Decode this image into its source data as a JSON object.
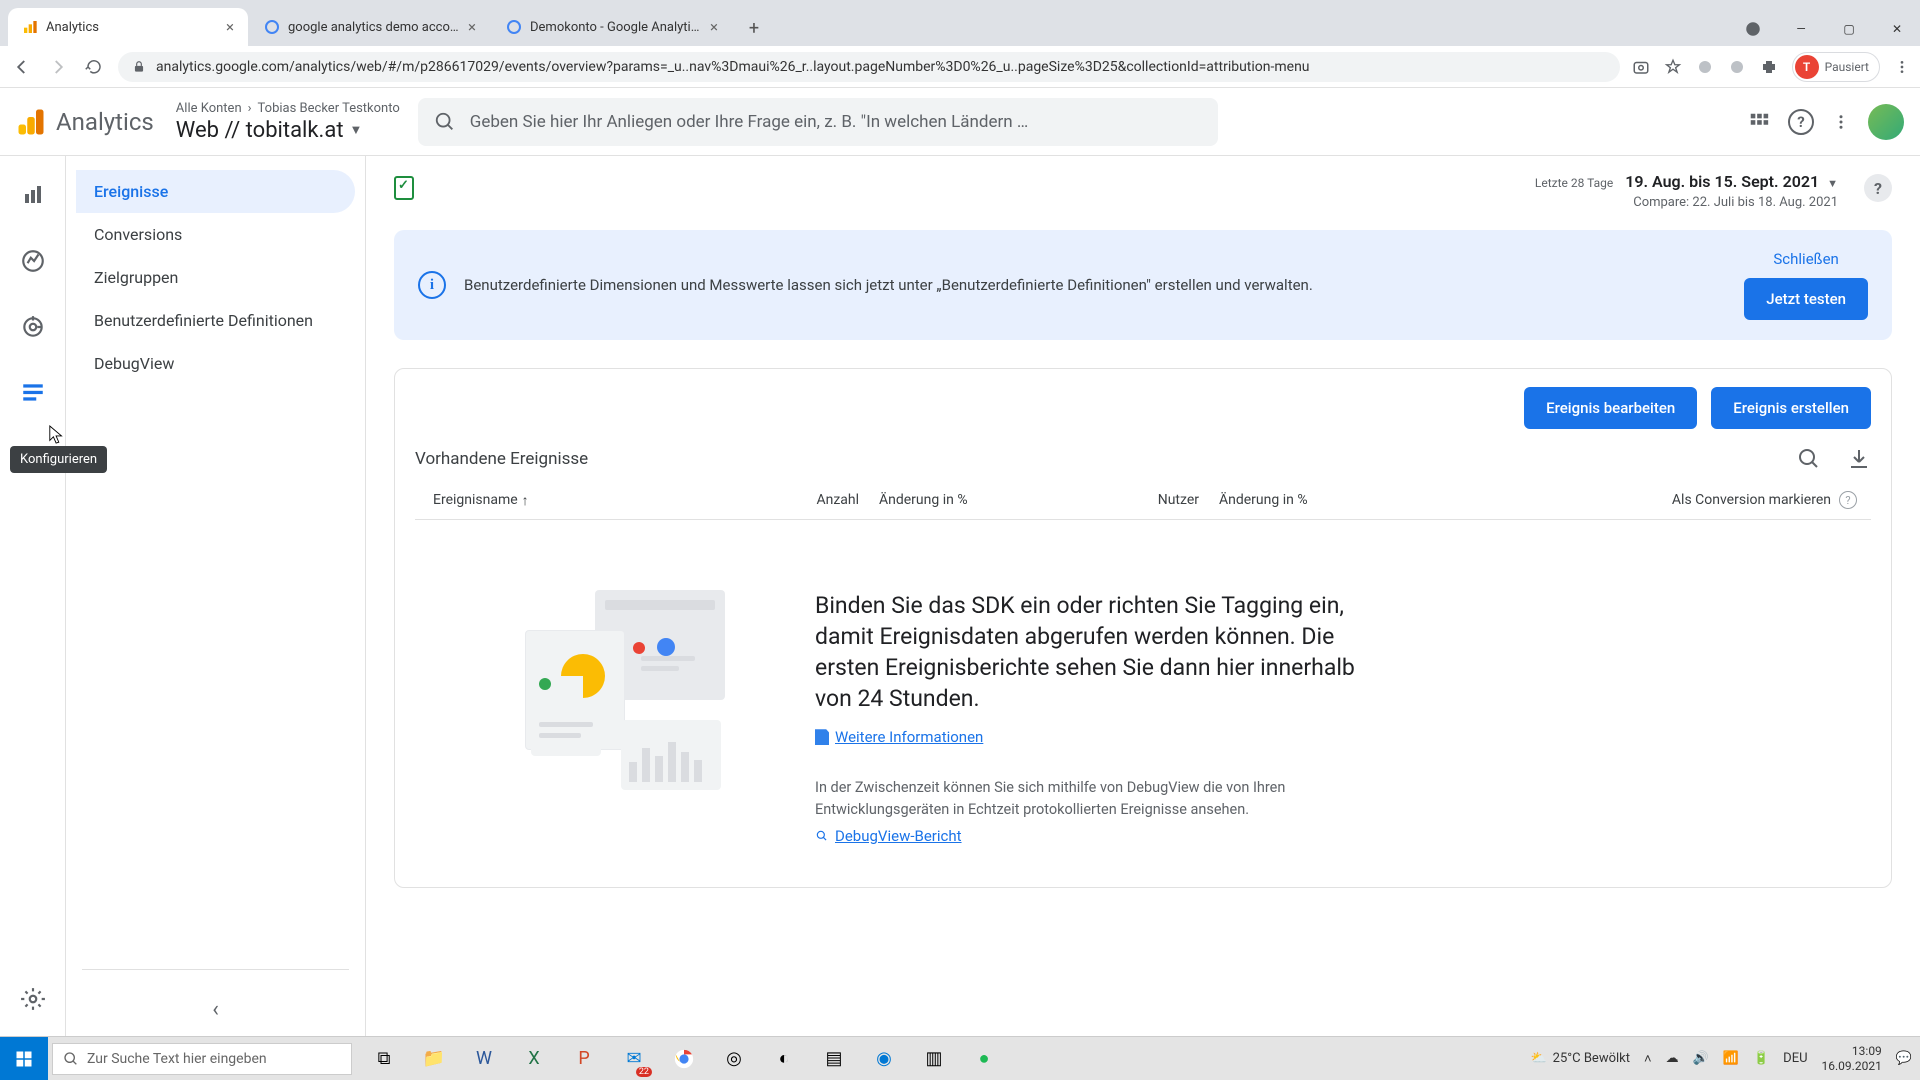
{
  "browser": {
    "tabs": [
      {
        "title": "Analytics",
        "active": true
      },
      {
        "title": "google analytics demo account",
        "active": false
      },
      {
        "title": "Demokonto - Google Analytics-I",
        "active": false
      }
    ],
    "url": "analytics.google.com/analytics/web/#/m/p286617029/events/overview?params=_u..nav%3Dmaui%26_r..layout.pageNumber%3D0%26_u..pageSize%3D25&collectionId=attribution-menu",
    "profile_label": "Pausiert",
    "profile_initial": "T"
  },
  "ga": {
    "brand": "Analytics",
    "breadcrumb_all": "Alle Konten",
    "breadcrumb_account": "Tobias Becker Testkonto",
    "property": "Web // tobitalk.at",
    "search_placeholder": "Geben Sie hier Ihr Anliegen oder Ihre Frage ein, z. B. \"In welchen Ländern …"
  },
  "rail_tooltip": "Konfigurieren",
  "subnav": {
    "items": [
      "Ereignisse",
      "Conversions",
      "Zielgruppen",
      "Benutzerdefinierte Definitionen",
      "DebugView"
    ],
    "active_index": 0
  },
  "date": {
    "label": "Letzte 28 Tage",
    "range": "19. Aug. bis 15. Sept. 2021",
    "compare": "Compare: 22. Juli bis 18. Aug. 2021"
  },
  "banner": {
    "text": "Benutzerdefinierte Dimensionen und Messwerte lassen sich jetzt unter „Benutzerdefinierte Definitionen\" erstellen und verwalten.",
    "close": "Schließen",
    "cta": "Jetzt testen"
  },
  "card": {
    "edit": "Ereignis bearbeiten",
    "create": "Ereignis erstellen",
    "title": "Vorhandene Ereignisse",
    "cols": {
      "name": "Ereignisname",
      "count": "Anzahl",
      "change1": "Änderung in %",
      "users": "Nutzer",
      "change2": "Änderung in %",
      "mark": "Als Conversion markieren"
    }
  },
  "empty": {
    "heading": "Binden Sie das SDK ein oder richten Sie Tagging ein, damit Ereignisdaten abgerufen werden können. Die ersten Ereignisberichte sehen Sie dann hier innerhalb von 24 Stunden.",
    "link1": "Weitere Informationen",
    "sub": "In der Zwischenzeit können Sie sich mithilfe von DebugView die von Ihren Entwicklungsgeräten in Echtzeit protokollierten Ereignisse ansehen.",
    "link2": "DebugView-Bericht"
  },
  "taskbar": {
    "search_placeholder": "Zur Suche Text hier eingeben",
    "weather": "25°C  Bewölkt",
    "lang": "DEU",
    "time": "13:09",
    "date": "16.09.2021",
    "mail_badge": "22"
  }
}
